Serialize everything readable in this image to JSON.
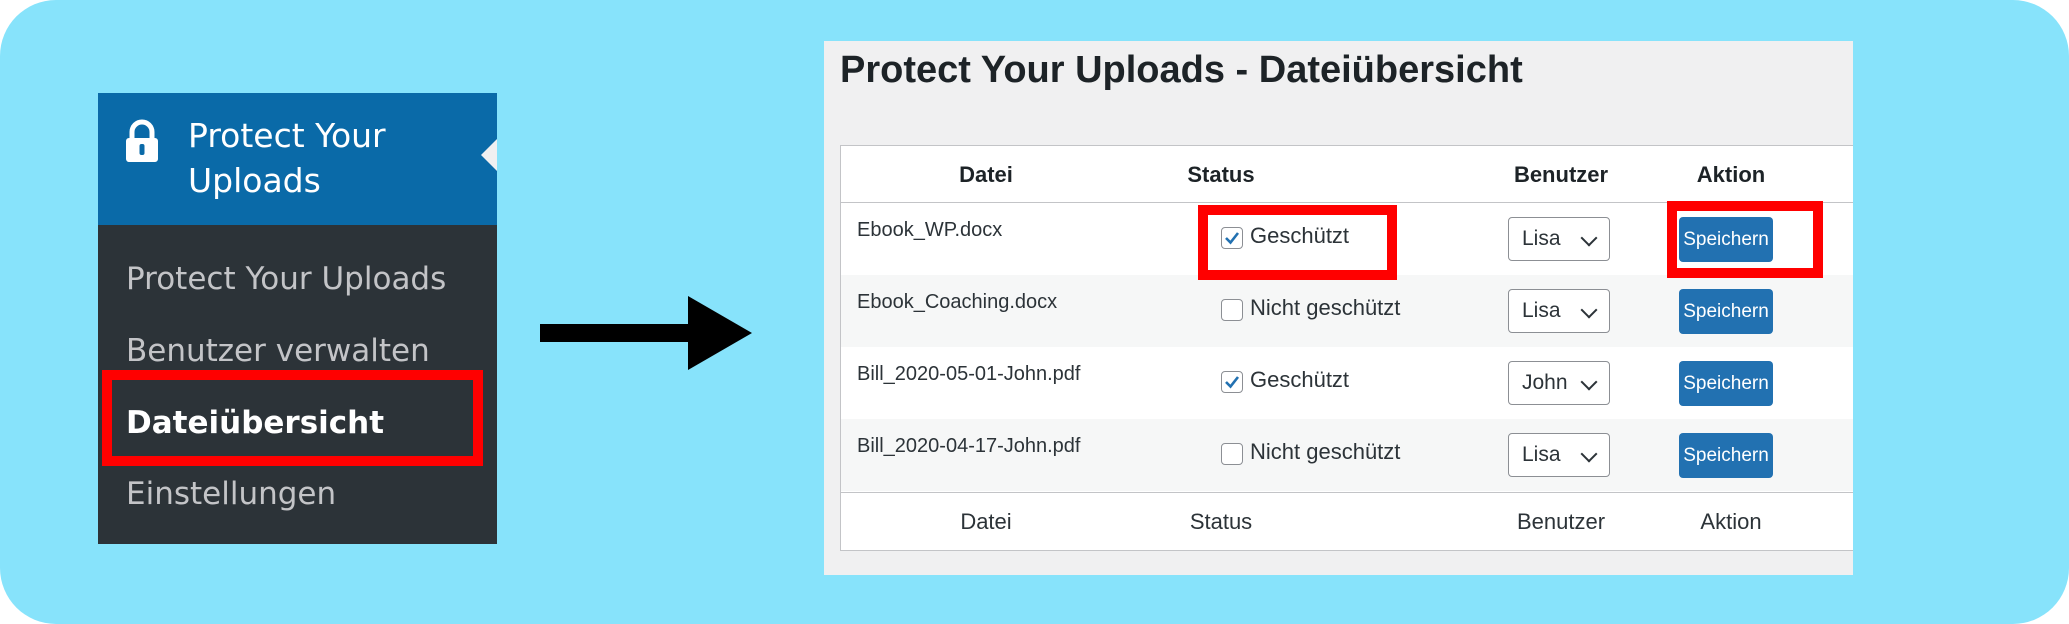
{
  "sidebar": {
    "title": "Protect Your Uploads",
    "title_line1": "Protect Your",
    "title_line2": "Uploads",
    "lock_icon": "lock-icon",
    "items": [
      {
        "label": "Protect Your Uploads",
        "current": false
      },
      {
        "label": "Benutzer verwalten",
        "current": false
      },
      {
        "label": "Dateiübersicht",
        "current": true
      },
      {
        "label": "Einstellungen",
        "current": false
      }
    ]
  },
  "arrow_icon": "arrow-right-icon",
  "panel": {
    "title": "Protect Your Uploads - Dateiübersicht",
    "columns": [
      "Datei",
      "Status",
      "Benutzer",
      "Aktion"
    ],
    "footer_columns": [
      "Datei",
      "Status",
      "Benutzer",
      "Aktion"
    ],
    "rows": [
      {
        "file": "Ebook_WP.docx",
        "checked": true,
        "status": "Geschützt",
        "user": "Lisa",
        "action": "Speichern"
      },
      {
        "file": "Ebook_Coaching.docx",
        "checked": false,
        "status": "Nicht geschützt",
        "user": "Lisa",
        "action": "Speichern"
      },
      {
        "file": "Bill_2020-05-01-John.pdf",
        "checked": true,
        "status": "Geschützt",
        "user": "John",
        "action": "Speichern"
      },
      {
        "file": "Bill_2020-04-17-John.pdf",
        "checked": false,
        "status": "Nicht geschützt",
        "user": "Lisa",
        "action": "Speichern"
      }
    ]
  },
  "colors": {
    "background": "#87e3fb",
    "menu_bg": "#2c3338",
    "menu_active": "#0a6aa8",
    "button": "#2271b1",
    "highlight": "#ff0000"
  }
}
